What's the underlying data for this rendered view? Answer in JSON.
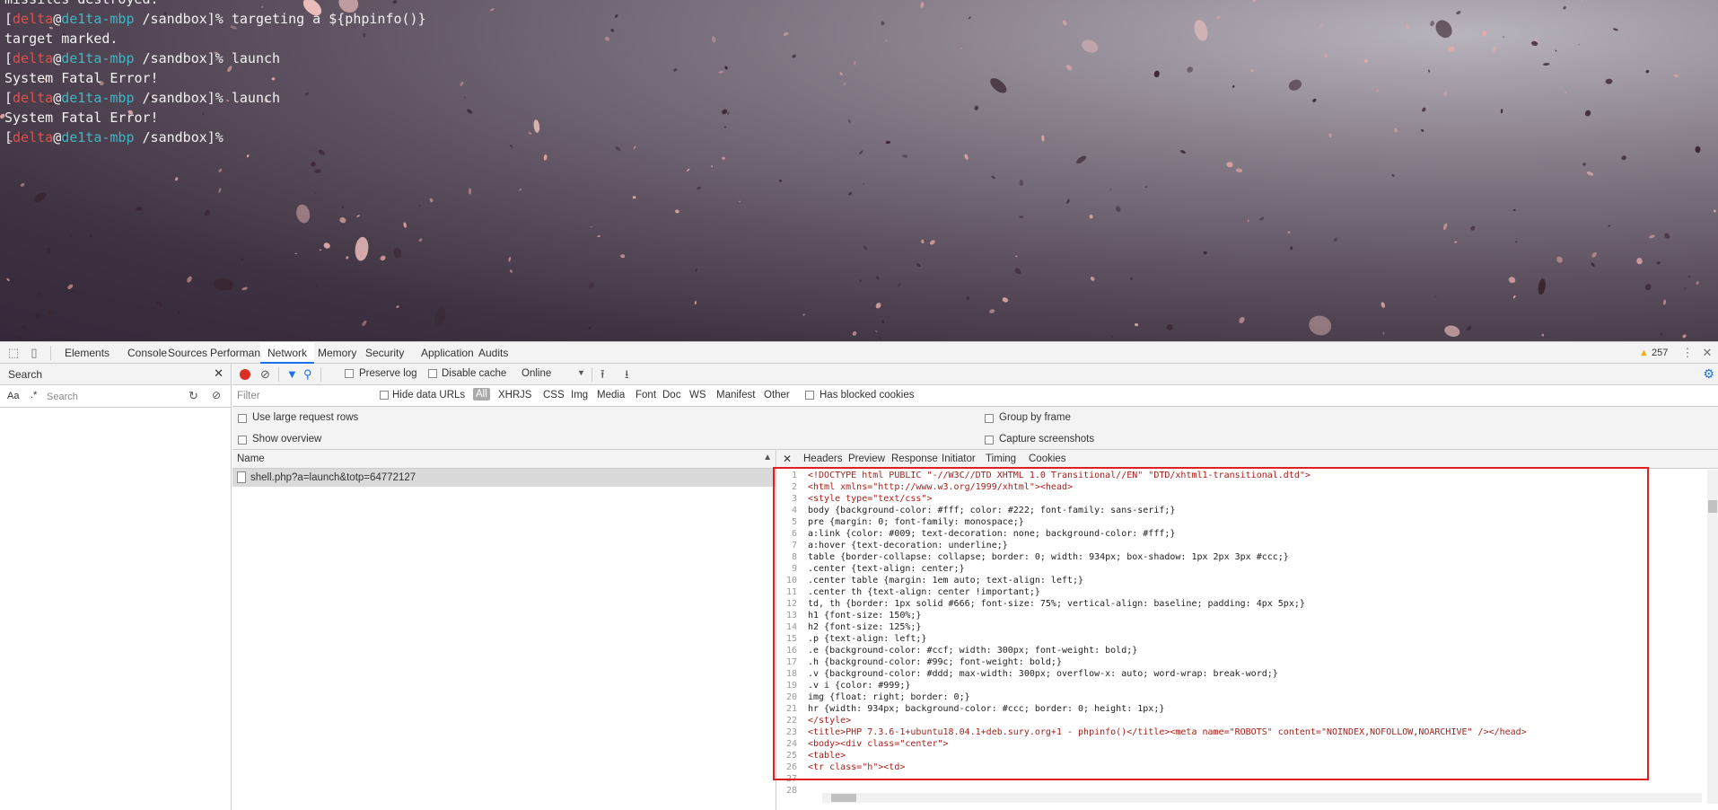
{
  "terminal": {
    "lines": [
      {
        "kind": "text",
        "text": "missiles destroyed."
      },
      {
        "kind": "prompt",
        "user": "delta",
        "host": "de1ta-mbp",
        "path": "/sandbox",
        "command": "targeting a ${phpinfo()}"
      },
      {
        "kind": "text",
        "text": "target marked."
      },
      {
        "kind": "prompt",
        "user": "delta",
        "host": "de1ta-mbp",
        "path": "/sandbox",
        "command": "launch"
      },
      {
        "kind": "text",
        "text": "System Fatal Error!"
      },
      {
        "kind": "prompt",
        "user": "delta",
        "host": "de1ta-mbp",
        "path": "/sandbox",
        "command": "launch"
      },
      {
        "kind": "text",
        "text": "System Fatal Error!"
      },
      {
        "kind": "prompt",
        "user": "delta",
        "host": "de1ta-mbp",
        "path": "/sandbox",
        "command": ""
      }
    ]
  },
  "devtools": {
    "icons": {
      "inspect": "inspect-element-icon",
      "device": "device-toolbar-icon",
      "more": "more-vert-icon",
      "close": "close-icon"
    },
    "tabs": [
      "Elements",
      "Console",
      "Sources",
      "Performance",
      "Network",
      "Memory",
      "Security",
      "Application",
      "Audits"
    ],
    "active_tab": "Network",
    "warning_count": "257",
    "search_panel": {
      "title": "Search",
      "case_label": "Aa",
      "regex_label": ".*",
      "placeholder": "Search"
    },
    "network": {
      "preserve_log": "Preserve log",
      "disable_cache": "Disable cache",
      "throttle": "Online",
      "filter_placeholder": "Filter",
      "hide_data_urls": "Hide data URLs",
      "types": [
        "All",
        "XHR",
        "JS",
        "CSS",
        "Img",
        "Media",
        "Font",
        "Doc",
        "WS",
        "Manifest",
        "Other"
      ],
      "has_blocked_cookies": "Has blocked cookies",
      "options": {
        "large_rows": "Use large request rows",
        "show_overview": "Show overview",
        "group_by_frame": "Group by frame",
        "capture_screenshots": "Capture screenshots"
      },
      "list_header": "Name",
      "requests": [
        "shell.php?a=launch&totp=64772127"
      ],
      "detail_tabs": [
        "Headers",
        "Preview",
        "Response",
        "Initiator",
        "Timing",
        "Cookies"
      ],
      "active_detail_tab": "Response",
      "code_lines": [
        "<!DOCTYPE html PUBLIC \"-//W3C//DTD XHTML 1.0 Transitional//EN\" \"DTD/xhtml1-transitional.dtd\">",
        "<html xmlns=\"http://www.w3.org/1999/xhtml\"><head>",
        "<style type=\"text/css\">",
        "body {background-color: #fff; color: #222; font-family: sans-serif;}",
        "pre {margin: 0; font-family: monospace;}",
        "a:link {color: #009; text-decoration: none; background-color: #fff;}",
        "a:hover {text-decoration: underline;}",
        "table {border-collapse: collapse; border: 0; width: 934px; box-shadow: 1px 2px 3px #ccc;}",
        ".center {text-align: center;}",
        ".center table {margin: 1em auto; text-align: left;}",
        ".center th {text-align: center !important;}",
        "td, th {border: 1px solid #666; font-size: 75%; vertical-align: baseline; padding: 4px 5px;}",
        "h1 {font-size: 150%;}",
        "h2 {font-size: 125%;}",
        ".p {text-align: left;}",
        ".e {background-color: #ccf; width: 300px; font-weight: bold;}",
        ".h {background-color: #99c; font-weight: bold;}",
        ".v {background-color: #ddd; max-width: 300px; overflow-x: auto; word-wrap: break-word;}",
        ".v i {color: #999;}",
        "img {float: right; border: 0;}",
        "hr {width: 934px; background-color: #ccc; border: 0; height: 1px;}",
        "</style>",
        "<title>PHP 7.3.6-1+ubuntu18.04.1+deb.sury.org+1 - phpinfo()</title><meta name=\"ROBOTS\" content=\"NOINDEX,NOFOLLOW,NOARCHIVE\" /></head>",
        "<body><div class=\"center\">",
        "<table>",
        "<tr class=\"h\"><td>",
        "",
        ""
      ]
    }
  }
}
